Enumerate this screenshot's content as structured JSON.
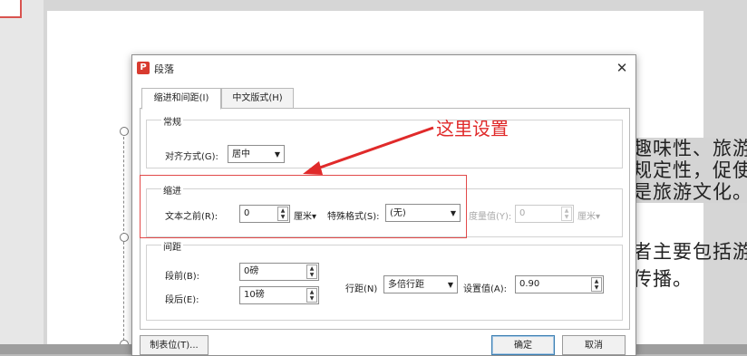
{
  "background": {
    "text_lines": [
      "趣味性、旅游",
      "规定性，促使",
      "是旅游文化。",
      "者主要包括游",
      "传播。"
    ]
  },
  "dialog": {
    "title": "段落",
    "tabs": [
      "缩进和间距(I)",
      "中文版式(H)"
    ],
    "general": {
      "group_label": "常规",
      "alignment_label": "对齐方式(G):",
      "alignment_value": "居中"
    },
    "indent": {
      "group_label": "缩进",
      "before_text_label": "文本之前(R):",
      "before_text_value": "0",
      "before_text_unit": "厘米",
      "special_label": "特殊格式(S):",
      "special_value": "(无)",
      "measure_label": "度量值(Y):",
      "measure_value": "0",
      "measure_unit": "厘米"
    },
    "spacing": {
      "group_label": "间距",
      "before_label": "段前(B):",
      "before_value": "0磅",
      "after_label": "段后(E):",
      "after_value": "10磅",
      "line_label": "行距(N)",
      "line_value": "多倍行距",
      "setting_label": "设置值(A):",
      "setting_value": "0.90"
    },
    "buttons": {
      "tabs": "制表位(T)...",
      "ok": "确定",
      "cancel": "取消"
    }
  },
  "annotation": {
    "text": "这里设置",
    "color": "#e02a2a"
  },
  "colors": {
    "accent": "#d83b30",
    "annotation": "#e24a4a"
  }
}
